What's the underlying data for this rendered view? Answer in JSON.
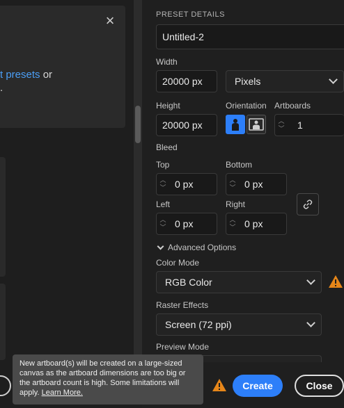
{
  "left": {
    "close_icon": "×",
    "text_link": "t presets",
    "text_after": " or",
    "text_line2": "."
  },
  "preset": {
    "section_title": "PRESET DETAILS",
    "name_value": "Untitled-2",
    "width_label": "Width",
    "width_value": "20000 px",
    "units_value": "Pixels",
    "height_label": "Height",
    "height_value": "20000 px",
    "orientation_label": "Orientation",
    "artboards_label": "Artboards",
    "artboards_value": "1",
    "bleed_label": "Bleed",
    "top_label": "Top",
    "top_value": "0 px",
    "bottom_label": "Bottom",
    "bottom_value": "0 px",
    "left_label": "Left",
    "left_value": "0 px",
    "right_label": "Right",
    "right_value": "0 px",
    "advanced_label": "Advanced Options",
    "color_mode_label": "Color Mode",
    "color_mode_value": "RGB Color",
    "raster_label": "Raster Effects",
    "raster_value": "Screen (72 ppi)",
    "preview_label": "Preview Mode"
  },
  "tooltip": {
    "text": "New artboard(s) will be created on a large-sized canvas as the artboard dimensions are too big or the artboard count is high. Some limitations will apply.",
    "link": "Learn More."
  },
  "actions": {
    "create_label": "Create",
    "close_label": "Close"
  },
  "colors": {
    "accent": "#2d7ff9",
    "warning": "#e68619",
    "link": "#4b9ef5"
  }
}
